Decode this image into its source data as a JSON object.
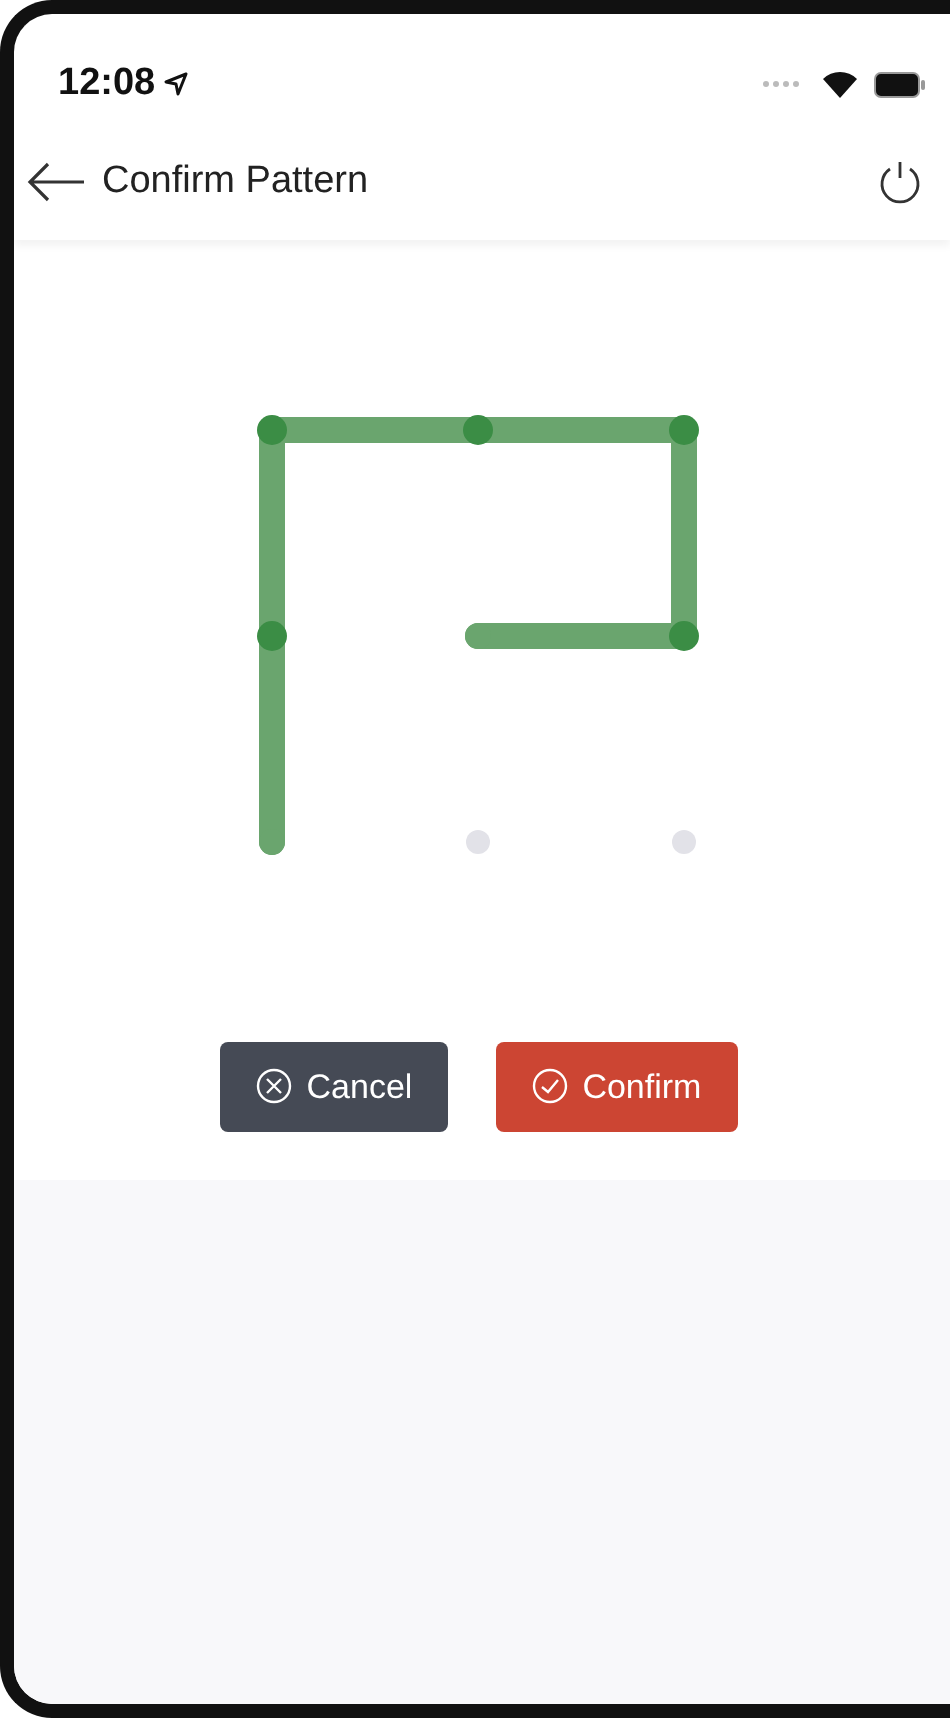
{
  "status_bar": {
    "time": "12:08"
  },
  "header": {
    "title": "Confirm Pattern"
  },
  "pattern": {
    "dots": [
      {
        "selected": true
      },
      {
        "selected": true
      },
      {
        "selected": true
      },
      {
        "selected": true
      },
      {
        "selected": false
      },
      {
        "selected": true
      },
      {
        "selected": false
      },
      {
        "selected": false
      },
      {
        "selected": false
      }
    ]
  },
  "buttons": [
    {
      "label": "Cancel",
      "kind": "cancel"
    },
    {
      "label": "Confirm",
      "kind": "confirm"
    }
  ]
}
